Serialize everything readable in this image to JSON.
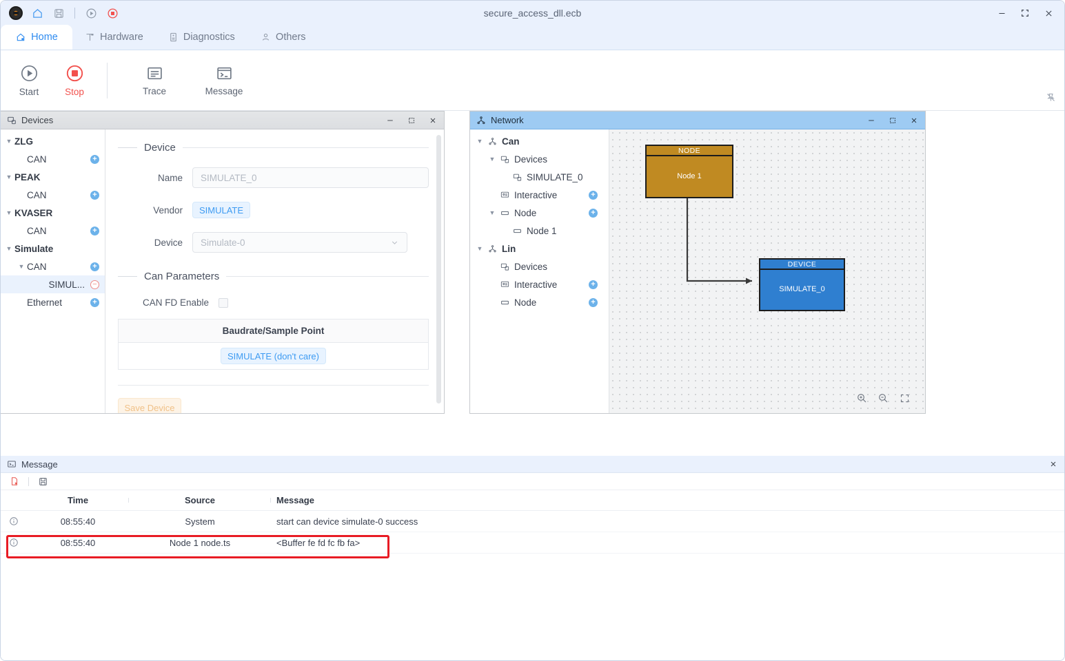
{
  "window": {
    "title": "secure_access_dll.ecb",
    "controls": {
      "minimize": "minimize-icon",
      "maximize": "maximize-icon",
      "close": "close-icon"
    },
    "quick_actions": [
      "app-logo",
      "home-icon",
      "save-icon",
      "start-icon",
      "stop-icon"
    ]
  },
  "tabs": [
    {
      "label": "Home",
      "icon": "home-cloud-icon",
      "active": true
    },
    {
      "label": "Hardware",
      "icon": "hardware-icon",
      "active": false
    },
    {
      "label": "Diagnostics",
      "icon": "diagnostics-icon",
      "active": false
    },
    {
      "label": "Others",
      "icon": "person-icon",
      "active": false
    }
  ],
  "ribbon": {
    "items": [
      {
        "label": "Start",
        "icon": "play-circle-icon"
      },
      {
        "label": "Stop",
        "icon": "stop-circle-icon"
      },
      {
        "label": "Trace",
        "icon": "trace-icon"
      },
      {
        "label": "Message",
        "icon": "console-icon"
      }
    ],
    "pin_icon": "unpin-icon"
  },
  "devices_panel": {
    "title": "Devices",
    "icon": "devices-icon",
    "tree": [
      {
        "label": "ZLG",
        "level": 0,
        "caret": "down",
        "root": true,
        "action": "none"
      },
      {
        "label": "CAN",
        "level": 1,
        "caret": "none",
        "root": false,
        "action": "plus"
      },
      {
        "label": "PEAK",
        "level": 0,
        "caret": "down",
        "root": true,
        "action": "none"
      },
      {
        "label": "CAN",
        "level": 1,
        "caret": "none",
        "root": false,
        "action": "plus"
      },
      {
        "label": "KVASER",
        "level": 0,
        "caret": "down",
        "root": true,
        "action": "none"
      },
      {
        "label": "CAN",
        "level": 1,
        "caret": "none",
        "root": false,
        "action": "plus"
      },
      {
        "label": "Simulate",
        "level": 0,
        "caret": "down",
        "root": true,
        "action": "none"
      },
      {
        "label": "CAN",
        "level": 1,
        "caret": "down",
        "root": false,
        "action": "plus"
      },
      {
        "label": "SIMUL...",
        "level": 2,
        "caret": "none",
        "root": false,
        "action": "minus",
        "selected": true
      },
      {
        "label": "Ethernet",
        "level": 1,
        "caret": "none",
        "root": false,
        "action": "plus"
      }
    ],
    "form": {
      "section_device": "Device",
      "name_label": "Name",
      "name_value": "SIMULATE_0",
      "vendor_label": "Vendor",
      "vendor_value": "SIMULATE",
      "device_label": "Device",
      "device_value": "Simulate-0",
      "section_can": "Can Parameters",
      "canfd_label": "CAN FD Enable",
      "canfd_checked": false,
      "table_header": "Baudrate/Sample Point",
      "table_value": "SIMULATE (don't care)",
      "save_label": "Save Device"
    }
  },
  "network_panel": {
    "title": "Network",
    "icon": "network-icon",
    "tree": [
      {
        "label": "Can",
        "level": 0,
        "caret": "down",
        "icon": "network-icon",
        "bold": true,
        "action": "none"
      },
      {
        "label": "Devices",
        "level": 1,
        "caret": "down",
        "icon": "devices-icon",
        "bold": false,
        "action": "none"
      },
      {
        "label": "SIMULATE_0",
        "level": 2,
        "caret": "none",
        "icon": "devices-icon",
        "bold": false,
        "action": "none"
      },
      {
        "label": "Interactive",
        "level": 1,
        "caret": "none",
        "icon": "interactive-icon",
        "bold": false,
        "action": "plus"
      },
      {
        "label": "Node",
        "level": 1,
        "caret": "down",
        "icon": "node-icon",
        "bold": false,
        "action": "plus"
      },
      {
        "label": "Node 1",
        "level": 2,
        "caret": "none",
        "icon": "node-icon",
        "bold": false,
        "action": "none"
      },
      {
        "label": "Lin",
        "level": 0,
        "caret": "down",
        "icon": "network-icon",
        "bold": true,
        "action": "none"
      },
      {
        "label": "Devices",
        "level": 1,
        "caret": "none",
        "icon": "devices-icon",
        "bold": false,
        "action": "none"
      },
      {
        "label": "Interactive",
        "level": 1,
        "caret": "none",
        "icon": "interactive-icon",
        "bold": false,
        "action": "plus"
      },
      {
        "label": "Node",
        "level": 1,
        "caret": "none",
        "icon": "node-icon",
        "bold": false,
        "action": "plus"
      }
    ],
    "diagram": {
      "node_box": {
        "type": "NODE",
        "name": "Node 1",
        "color": "#c08a22"
      },
      "device_box": {
        "type": "DEVICE",
        "name": "SIMULATE_0",
        "color": "#2f7fd0"
      },
      "connector": "node-to-device-arrow"
    },
    "canvas_tools": [
      {
        "name": "zoom-in-icon"
      },
      {
        "name": "zoom-out-icon"
      },
      {
        "name": "fit-screen-icon"
      }
    ]
  },
  "message_panel": {
    "title": "Message",
    "icon": "console-icon",
    "toolbar": [
      {
        "name": "clear-log-icon"
      },
      {
        "name": "save-log-icon"
      }
    ],
    "columns": [
      "Time",
      "Source",
      "Message"
    ],
    "rows": [
      {
        "icon": "info-icon",
        "time": "08:55:40",
        "source": "System",
        "message": "start can device simulate-0 success",
        "highlighted": false
      },
      {
        "icon": "info-icon",
        "time": "08:55:40",
        "source": "Node 1 node.ts",
        "message": "<Buffer fe fd fc fb fa>",
        "highlighted": true
      }
    ],
    "highlight_color": "#e81b24"
  },
  "colors": {
    "accent": "#2e8bf0",
    "stop": "#f2514d",
    "active_panel_header": "#9ecbf3",
    "inactive_panel_header": "#e0e2e5"
  }
}
